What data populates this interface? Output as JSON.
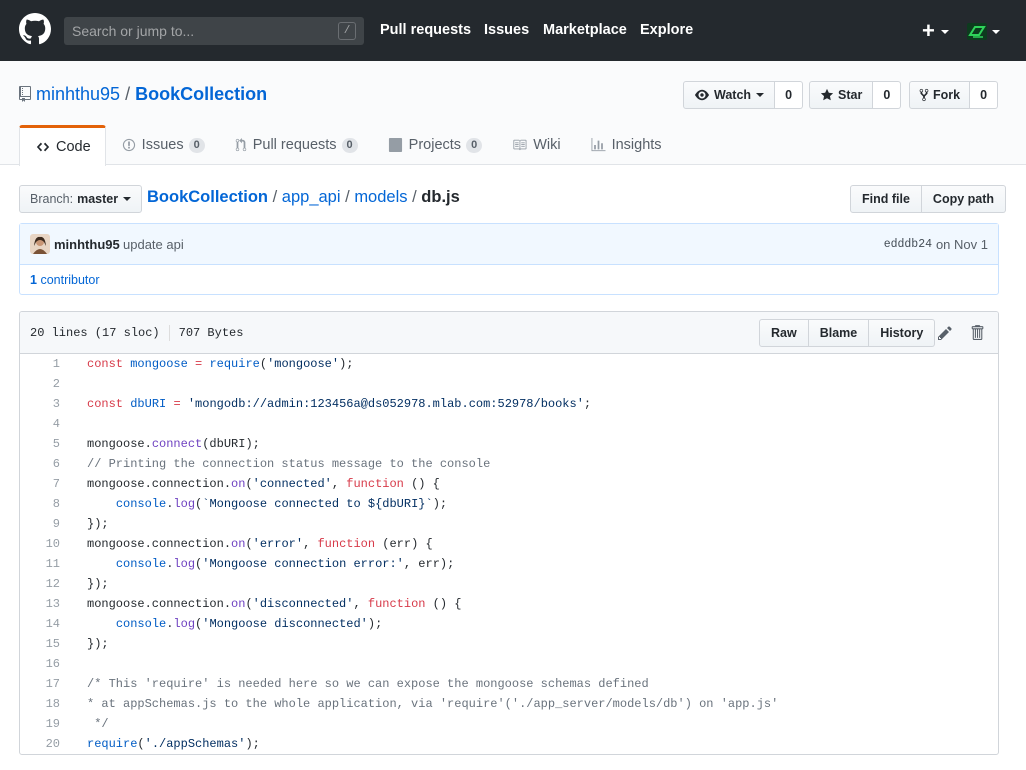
{
  "header": {
    "search_placeholder": "Search or jump to...",
    "search_shortcut": "/",
    "nav": [
      "Pull requests",
      "Issues",
      "Marketplace",
      "Explore"
    ],
    "plus": "+"
  },
  "repo": {
    "owner": "minhthu95",
    "separator": "/",
    "name": "BookCollection",
    "watch_label": "Watch",
    "watch_count": "0",
    "star_label": "Star",
    "star_count": "0",
    "fork_label": "Fork",
    "fork_count": "0"
  },
  "tabs": [
    {
      "label": "Code",
      "count": null,
      "icon": "code-icon"
    },
    {
      "label": "Issues",
      "count": "0",
      "icon": "issue-icon"
    },
    {
      "label": "Pull requests",
      "count": "0",
      "icon": "pull-request-icon"
    },
    {
      "label": "Projects",
      "count": "0",
      "icon": "project-icon"
    },
    {
      "label": "Wiki",
      "count": null,
      "icon": "book-icon"
    },
    {
      "label": "Insights",
      "count": null,
      "icon": "graph-icon"
    }
  ],
  "branch": {
    "label": "Branch:",
    "name": "master"
  },
  "breadcrumb": {
    "root": "BookCollection",
    "parts": [
      "app_api",
      "models"
    ],
    "file": "db.js",
    "sep": "/"
  },
  "file_buttons": {
    "find": "Find file",
    "copy": "Copy path"
  },
  "commit": {
    "author": "minhthu95",
    "message": "update api",
    "sha": "edddb24",
    "date": "on Nov 1",
    "contributors_count": "1",
    "contributors_label": "contributor"
  },
  "file": {
    "lines_info": "20 lines (17 sloc)",
    "size": "707 Bytes",
    "buttons": [
      "Raw",
      "Blame",
      "History"
    ]
  },
  "code_lines": [
    "const mongoose = require('mongoose');",
    "",
    "const dbURI = 'mongodb://admin:123456a@ds052978.mlab.com:52978/books';",
    "",
    "mongoose.connect(dbURI);",
    "// Printing the connection status message to the console",
    "mongoose.connection.on('connected', function () {",
    "    console.log(`Mongoose connected to ${dbURI}`);",
    "});",
    "mongoose.connection.on('error', function (err) {",
    "    console.log('Mongoose connection error:', err);",
    "});",
    "mongoose.connection.on('disconnected', function () {",
    "    console.log('Mongoose disconnected');",
    "});",
    "",
    "/* This 'require' is needed here so we can expose the mongoose schemas defined",
    "* at appSchemas.js to the whole application, via 'require'('./app_server/models/db') on 'app.js'",
    " */",
    "require('./appSchemas');"
  ],
  "colors": {
    "header_bg": "#24292e",
    "link": "#0366d6",
    "tab_accent": "#e36209",
    "keyword": "#d73a49",
    "string": "#032f62",
    "comment": "#6a737d",
    "function": "#6f42c1",
    "variable": "#005cc5"
  }
}
